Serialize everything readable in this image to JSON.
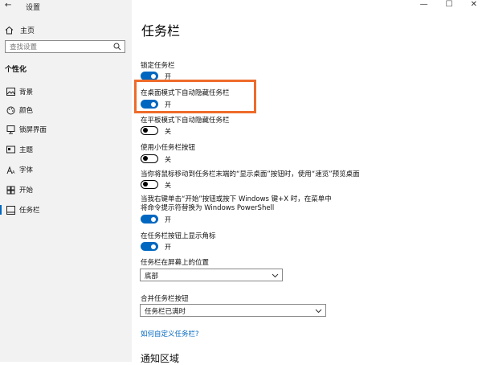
{
  "window": {
    "title": "设置",
    "back_glyph": "←"
  },
  "sidebar": {
    "home_label": "主页",
    "search_placeholder": "查找设置",
    "section": "个性化",
    "items": [
      {
        "label": "背景",
        "icon": "picture-icon"
      },
      {
        "label": "颜色",
        "icon": "palette-icon"
      },
      {
        "label": "锁屏界面",
        "icon": "lock-screen-icon"
      },
      {
        "label": "主题",
        "icon": "theme-icon"
      },
      {
        "label": "字体",
        "icon": "font-icon"
      },
      {
        "label": "开始",
        "icon": "start-icon"
      },
      {
        "label": "任务栏",
        "icon": "taskbar-icon",
        "active": true
      }
    ]
  },
  "window_controls": {
    "minimize": "—",
    "maximize": "☐",
    "close": "✕"
  },
  "main": {
    "title": "任务栏",
    "settings": [
      {
        "label": "锁定任务栏",
        "state": "开",
        "on": true
      },
      {
        "label": "在桌面模式下自动隐藏任务栏",
        "state": "开",
        "on": true
      },
      {
        "label": "在平板模式下自动隐藏任务栏",
        "state": "关",
        "on": false
      },
      {
        "label": "使用小任务栏按钮",
        "state": "关",
        "on": false
      },
      {
        "label": "当你将鼠标移动到任务栏末端的“显示桌面”按钮时，使用“速览”预览桌面",
        "state": "关",
        "on": false
      },
      {
        "label": "当我右键单击“开始”按钮或按下 Windows 键+X 时，在菜单中将命令提示符替换为 Windows PowerShell",
        "state": "开",
        "on": true
      },
      {
        "label": "在任务栏按钮上显示角标",
        "state": "开",
        "on": true
      }
    ],
    "position": {
      "label": "任务栏在屏幕上的位置",
      "value": "底部"
    },
    "combine": {
      "label": "合并任务栏按钮",
      "value": "任务栏已满时"
    },
    "help_link": "如何自定义任务栏?",
    "next_section": "通知区域"
  },
  "colors": {
    "accent": "#0067c0",
    "highlight": "#ee6b2a",
    "sidebar_bg": "#f2f2f2"
  }
}
